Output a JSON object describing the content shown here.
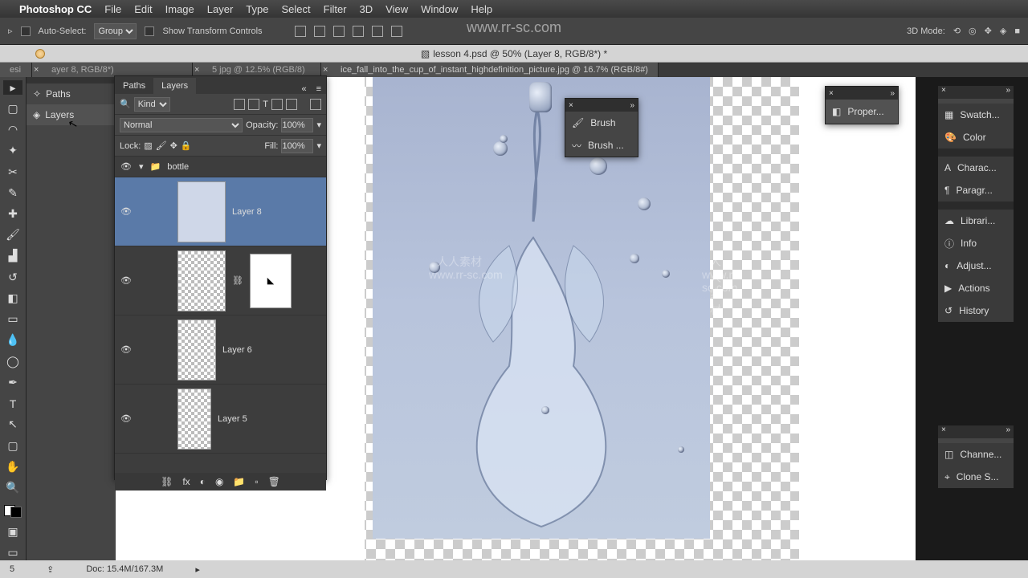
{
  "menubar": {
    "app": "Photoshop CC",
    "items": [
      "File",
      "Edit",
      "Image",
      "Layer",
      "Type",
      "Select",
      "Filter",
      "3D",
      "View",
      "Window",
      "Help"
    ]
  },
  "options": {
    "auto_select": "Auto-Select:",
    "group": "Group",
    "show_transform": "Show Transform Controls",
    "mode_label": "3D Mode:"
  },
  "watermark_url": "www.rr-sc.com",
  "doc_title": "lesson 4.psd @ 50% (Layer 8, RGB/8*) *",
  "tabs": {
    "t0": "esi",
    "t1": "ayer 8, RGB/8*)",
    "t2": "5 jpg @ 12.5% (RGB/8)",
    "t3": "ice_fall_into_the_cup_of_instant_highdefinition_picture.jpg @ 16.7% (RGB/8#)"
  },
  "left_dock": {
    "paths": "Paths",
    "layers": "Layers"
  },
  "layers_panel": {
    "tabs": {
      "paths": "Paths",
      "layers": "Layers"
    },
    "kind": "Kind",
    "blend": "Normal",
    "opacity_label": "Opacity:",
    "opacity": "100%",
    "lock_label": "Lock:",
    "fill_label": "Fill:",
    "fill": "100%",
    "group_name": "bottle",
    "layer8": "Layer 8",
    "layer6": "Layer 6",
    "layer5": "Layer 5"
  },
  "brush_panel": {
    "brush": "Brush",
    "brush_presets": "Brush ..."
  },
  "properties_panel": {
    "title": "Proper..."
  },
  "right_dock": {
    "swatches": "Swatch...",
    "color": "Color",
    "character": "Charac...",
    "paragraph": "Paragr...",
    "libraries": "Librari...",
    "info": "Info",
    "adjustments": "Adjust...",
    "actions": "Actions",
    "history": "History",
    "channels": "Channe...",
    "clone_source": "Clone S..."
  },
  "status": {
    "zoom": "5",
    "doc": "Doc: 15.4M/167.3M"
  },
  "watermarks": {
    "brand": "人人素材",
    "url": "www.rr-sc.com"
  }
}
